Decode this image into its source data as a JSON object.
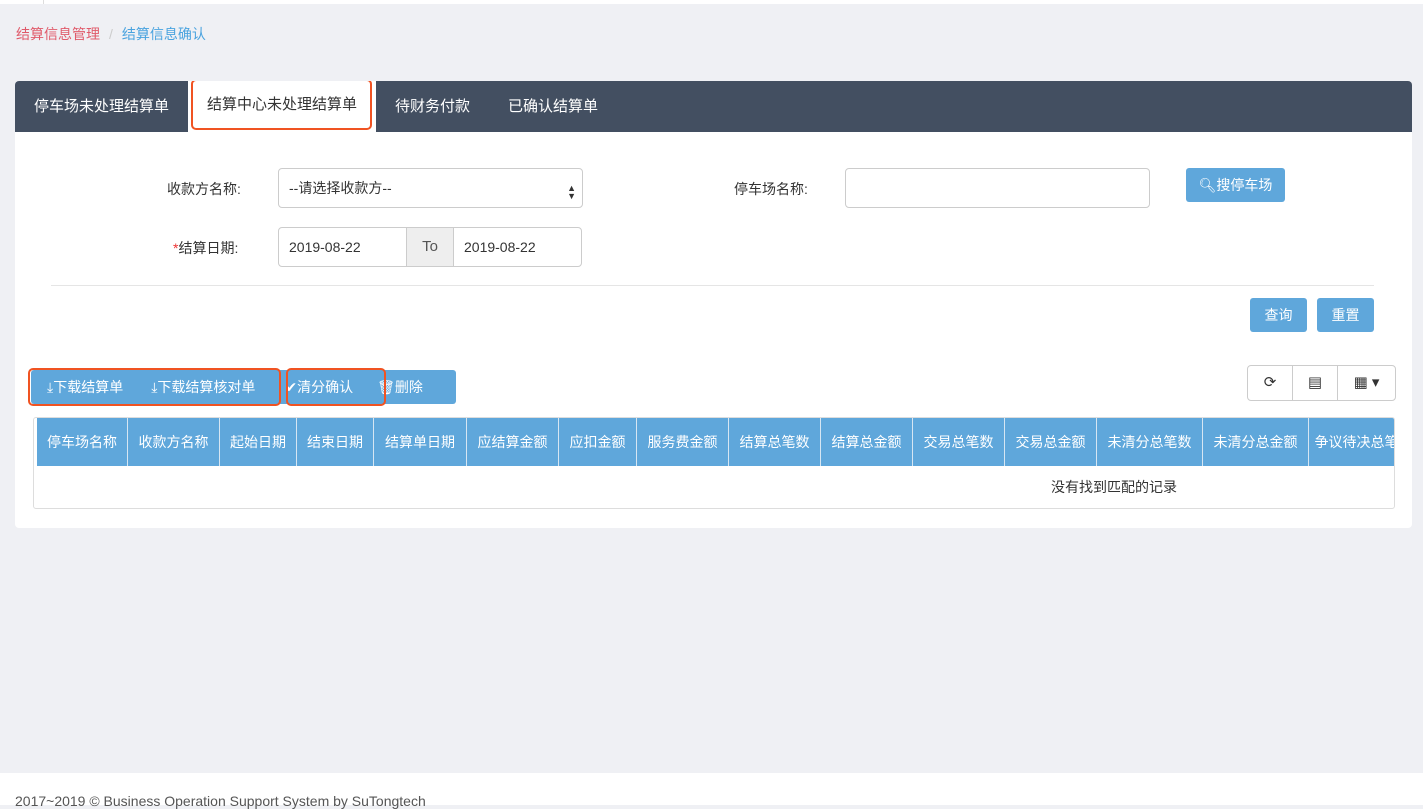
{
  "breadcrumb": {
    "parent": "结算信息管理",
    "current": "结算信息确认"
  },
  "tabs": [
    {
      "label": "停车场未处理结算单"
    },
    {
      "label": "结算中心未处理结算单",
      "active": true
    },
    {
      "label": "待财务付款"
    },
    {
      "label": "已确认结算单"
    }
  ],
  "form": {
    "payee_label": "收款方名称:",
    "payee_value": "--请选择收款方--",
    "parking_label": "停车场名称:",
    "parking_value": "",
    "search_parking": "搜停车场",
    "date_label": "结算日期:",
    "date_required": "*",
    "date_from": "2019-08-22",
    "date_to_label": "To",
    "date_to": "2019-08-22",
    "query": "查询",
    "reset": "重置"
  },
  "toolbar": {
    "download_statement": "下载结算单",
    "download_reconciliation": "下载结算核对单",
    "clear_confirm": "清分确认",
    "delete": "删除"
  },
  "table": {
    "columns": [
      "停车场名称",
      "收款方名称",
      "起始日期",
      "结束日期",
      "结算单日期",
      "应结算金额",
      "应扣金额",
      "服务费金额",
      "结算总笔数",
      "结算总金额",
      "交易总笔数",
      "交易总金额",
      "未清分总笔数",
      "未清分总金额",
      "争议待决总笔数"
    ],
    "empty_text": "没有找到匹配的记录"
  },
  "footer": "2017~2019 © Business Operation Support System by SuTongtech",
  "colors": {
    "tab_bar": "#434f61",
    "primary": "#5fa7db",
    "highlight": "#f05322",
    "breadcrumb_parent": "#e05a6a",
    "breadcrumb_current": "#4aa3df"
  }
}
